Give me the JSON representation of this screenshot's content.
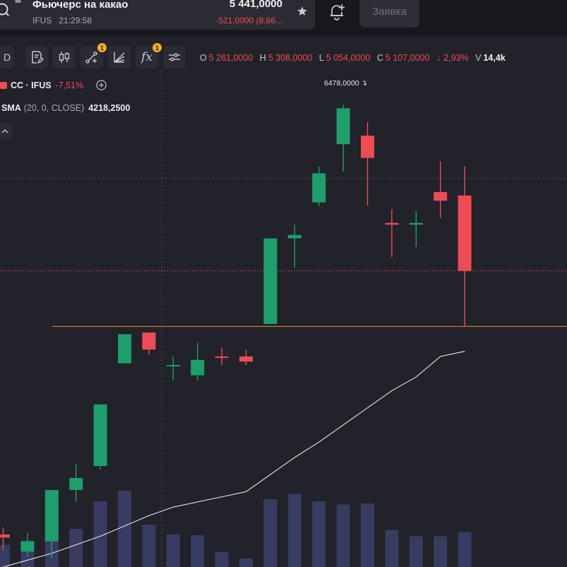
{
  "header": {
    "instrument_title": "Фьючерс на какао",
    "exchange": "IFUS",
    "time": "21:29:58",
    "last_price": "5 441,0000",
    "price_change": "-521,0000 (8,86...",
    "order_button_label": "Заявка"
  },
  "toolbar": {
    "timeframe_label": "D",
    "indicators_label": "fx",
    "drawing_badge": "1",
    "indicators_badge": "1"
  },
  "ohlc": {
    "o_label": "O",
    "o_value": "5 261,0000",
    "h_label": "H",
    "h_value": "5 308,0000",
    "l_label": "L",
    "l_value": "5 054,0000",
    "c_label": "C",
    "c_value": "5 107,0000",
    "change_arrow": "↓",
    "change_pct": "2,93%",
    "v_label": "V",
    "v_value": "14,4k"
  },
  "legend": {
    "symbol": "CC · IFUS",
    "symbol_change": "-7,51%",
    "sma_name": "SMA",
    "sma_params": "(20, 0, CLOSE)",
    "sma_value": "4218,2500"
  },
  "colors": {
    "up": "#1e9e6b",
    "down": "#ef4b55",
    "volume": "#3a3f66",
    "sma_line": "#e8e8ea",
    "support_line": "#c9772b",
    "price_line": "#ef4b55"
  },
  "chart_data": {
    "type": "candlestick",
    "y_unit": "price",
    "peak_label": "6478,0000",
    "candles": [
      {
        "o": 3840,
        "h": 3880,
        "l": 3750,
        "c": 3822,
        "v": 2.1
      },
      {
        "o": 3740,
        "h": 3850,
        "l": 3710,
        "c": 3800,
        "v": 2.5
      },
      {
        "o": 3800,
        "h": 4100,
        "l": 3700,
        "c": 4100,
        "v": 6.3
      },
      {
        "o": 4100,
        "h": 4250,
        "l": 4030,
        "c": 4170,
        "v": 3.6
      },
      {
        "o": 4240,
        "h": 4600,
        "l": 4220,
        "c": 4600,
        "v": 6.2
      },
      {
        "o": 4840,
        "h": 5010,
        "l": 4840,
        "c": 5010,
        "v": 7.2
      },
      {
        "o": 5020,
        "h": 5020,
        "l": 4890,
        "c": 4920,
        "v": 4.0
      },
      {
        "o": 4830,
        "h": 4880,
        "l": 4740,
        "c": 4830,
        "v": 3.1
      },
      {
        "o": 4770,
        "h": 4960,
        "l": 4740,
        "c": 4860,
        "v": 3.0
      },
      {
        "o": 4880,
        "h": 4930,
        "l": 4830,
        "c": 4875,
        "v": 1.4
      },
      {
        "o": 4880,
        "h": 4920,
        "l": 4830,
        "c": 4850,
        "v": 0.8
      },
      {
        "o": 5070,
        "h": 5570,
        "l": 5070,
        "c": 5570,
        "v": 6.4
      },
      {
        "o": 5570,
        "h": 5650,
        "l": 5400,
        "c": 5590,
        "v": 6.9
      },
      {
        "o": 5780,
        "h": 5990,
        "l": 5760,
        "c": 5950,
        "v": 6.2
      },
      {
        "o": 6120,
        "h": 6350,
        "l": 5960,
        "c": 6330,
        "v": 5.9
      },
      {
        "o": 6170,
        "h": 6250,
        "l": 5760,
        "c": 6040,
        "v": 6.0
      },
      {
        "o": 5660,
        "h": 5740,
        "l": 5460,
        "c": 5650,
        "v": 3.5
      },
      {
        "o": 5650,
        "h": 5730,
        "l": 5520,
        "c": 5660,
        "v": 2.9
      },
      {
        "o": 5840,
        "h": 6020,
        "l": 5690,
        "c": 5790,
        "v": 2.9
      },
      {
        "o": 5820,
        "h": 5990,
        "l": 5055,
        "c": 5380,
        "v": 3.3
      }
    ],
    "sma": [
      3650,
      3690,
      3730,
      3780,
      3830,
      3890,
      3950,
      4000,
      4030,
      4060,
      4090,
      4190,
      4290,
      4380,
      4480,
      4580,
      4680,
      4760,
      4880,
      4910
    ],
    "support_level": 5055,
    "price_line": 5380,
    "ylim": [
      3650,
      6550
    ]
  }
}
